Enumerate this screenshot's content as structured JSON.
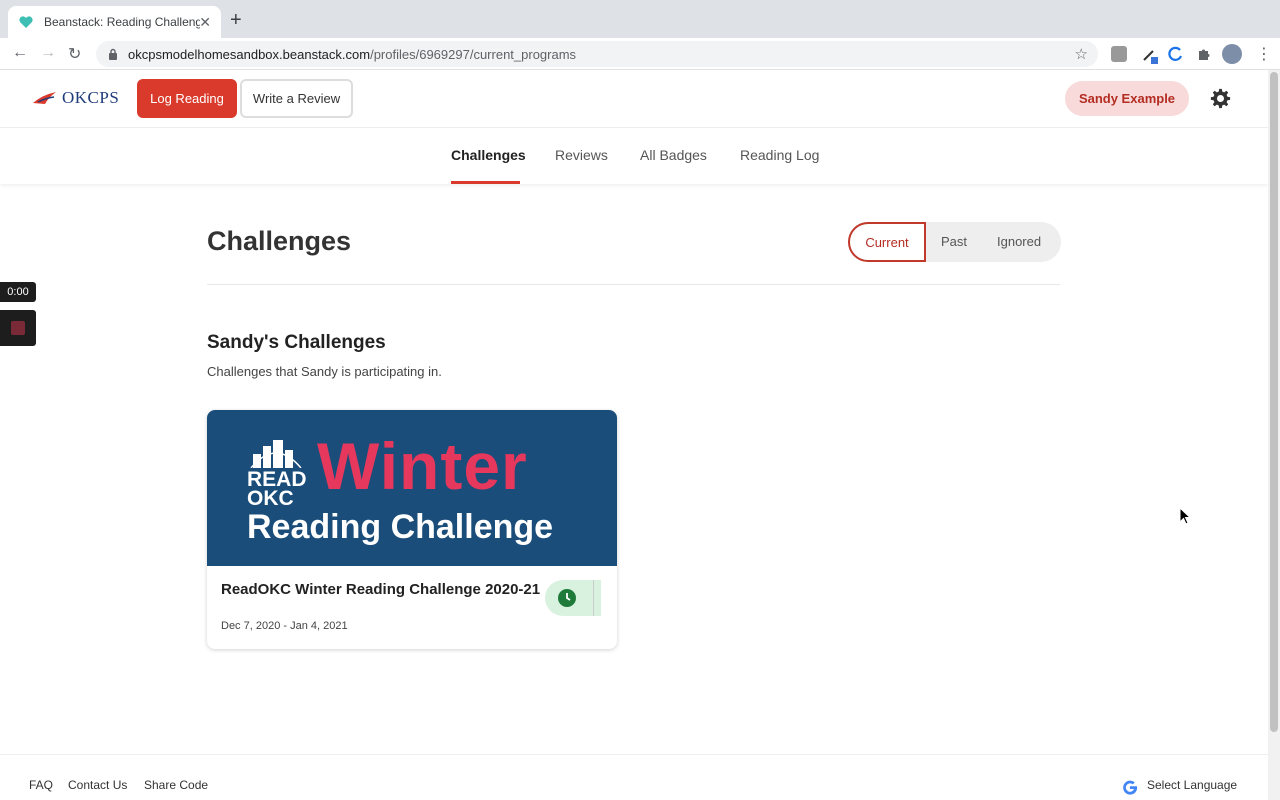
{
  "browser": {
    "tab_title": "Beanstack: Reading Challenge",
    "url_host": "okcpsmodelhomesandbox.beanstack.com",
    "url_path": "/profiles/6969297/current_programs"
  },
  "header": {
    "logo_text": "OKCPS",
    "log_reading": "Log Reading",
    "write_review": "Write a Review",
    "user_name": "Sandy Example"
  },
  "subnav": {
    "items": [
      {
        "label": "Challenges",
        "active": true
      },
      {
        "label": "Reviews"
      },
      {
        "label": "All Badges"
      },
      {
        "label": "Reading Log"
      }
    ]
  },
  "main": {
    "title": "Challenges",
    "filters": [
      "Current",
      "Past",
      "Ignored"
    ],
    "section_title": "Sandy's Challenges",
    "section_sub": "Challenges that Sandy is participating in.",
    "card": {
      "banner_read": "READ",
      "banner_okc": "OKC",
      "banner_winter": "Winter",
      "banner_rc": "Reading Challenge",
      "title": "ReadOKC Winter Reading Challenge 2020-21",
      "dates": "Dec 7, 2020 - Jan 4, 2021"
    }
  },
  "recorder": {
    "time": "0:00"
  },
  "footer": {
    "faq": "FAQ",
    "contact": "Contact Us",
    "share": "Share Code",
    "language": "Select Language"
  },
  "colors": {
    "accent": "#d93a2b",
    "banner": "#1a4d7a",
    "pill": "#f8dada"
  }
}
